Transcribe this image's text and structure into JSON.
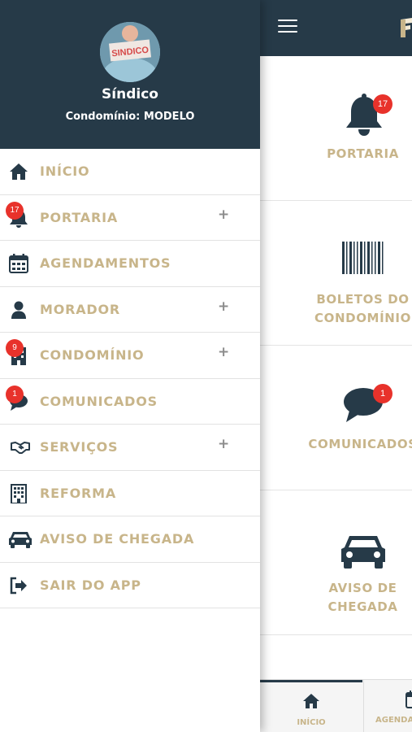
{
  "colors": {
    "header_bg": "#263a48",
    "accent_text": "#c8b58a",
    "badge": "#e8322b",
    "icon": "#263a48"
  },
  "drawer": {
    "user_name": "Síndico",
    "avatar_text": "SINDICO",
    "condo_label": "Condomínio:",
    "condo_value": "MODELO",
    "items": [
      {
        "label": "INÍCIO",
        "icon": "home-icon",
        "badge": null,
        "expand": ""
      },
      {
        "label": "PORTARIA",
        "icon": "bell-icon",
        "badge": "17",
        "expand": "+"
      },
      {
        "label": "AGENDAMENTOS",
        "icon": "calendar-icon",
        "badge": null,
        "expand": ""
      },
      {
        "label": "MORADOR",
        "icon": "user-icon",
        "badge": null,
        "expand": "+"
      },
      {
        "label": "CONDOMÍNIO",
        "icon": "building-icon",
        "badge": "9",
        "expand": "+"
      },
      {
        "label": "COMUNICADOS",
        "icon": "chat-icon",
        "badge": "1",
        "expand": ""
      },
      {
        "label": "SERVIÇOS",
        "icon": "handshake-icon",
        "badge": null,
        "expand": "+"
      },
      {
        "label": "REFORMA",
        "icon": "office-icon",
        "badge": null,
        "expand": ""
      },
      {
        "label": "AVISO DE CHEGADA",
        "icon": "car-icon",
        "badge": null,
        "expand": ""
      },
      {
        "label": "SAIR DO APP",
        "icon": "sign-out-icon",
        "badge": null,
        "expand": ""
      }
    ]
  },
  "main": {
    "tiles": [
      {
        "line1": "PORTARIA",
        "line2": "",
        "icon": "bell-icon",
        "badge": "17"
      },
      {
        "line1": "BOLETOS DO",
        "line2": "CONDOMÍNIO",
        "icon": "barcode-icon",
        "badge": null
      },
      {
        "line1": "COMUNICADOS",
        "line2": "",
        "icon": "chat-icon",
        "badge": "1"
      },
      {
        "line1": "AVISO DE",
        "line2": "CHEGADA",
        "icon": "car-icon",
        "badge": null
      }
    ],
    "tabs": [
      {
        "label": "INÍCIO",
        "icon": "home-icon"
      },
      {
        "label": "AGENDAMENTOS",
        "icon": "calendar-icon"
      }
    ]
  }
}
